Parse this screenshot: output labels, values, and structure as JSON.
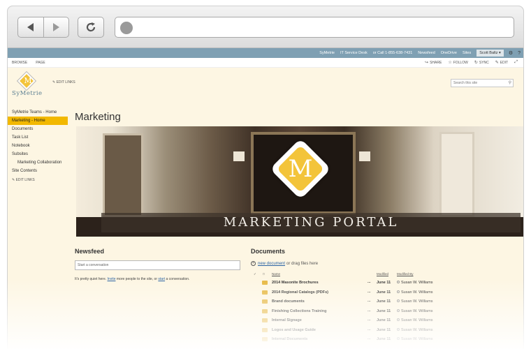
{
  "suitebar": {
    "links": [
      "SyMetrie",
      "IT Service Desk",
      "or Call 1-855-638-7431",
      "Newsfeed",
      "OneDrive",
      "Sites"
    ],
    "user": "Scott Baltz ▾"
  },
  "ribbon": {
    "tabs": [
      "BROWSE",
      "PAGE"
    ],
    "actions": {
      "share": "SHARE",
      "follow": "FOLLOW",
      "sync": "SYNC",
      "edit": "EDIT"
    }
  },
  "site": {
    "logo_letter": "M",
    "name": "SyMetrie",
    "edit_links": "EDIT LINKS",
    "search_placeholder": "Search this site"
  },
  "nav": {
    "items": [
      "SyMetrie Teams - Home",
      "Marketing - Home",
      "Documents",
      "Task List",
      "Notebook",
      "Subsites",
      "Marketing Collaboration",
      "Site Contents"
    ],
    "edit_links": "EDIT LINKS"
  },
  "page": {
    "title": "Marketing"
  },
  "banner": {
    "letter": "M",
    "text": "MARKETING PORTAL"
  },
  "newsfeed": {
    "title": "Newsfeed",
    "placeholder": "Start a conversation",
    "note_1": "It's pretty quiet here.",
    "invite": "Invite",
    "note_2": "more people to the site, or",
    "start": "start",
    "note_3": "a conversation."
  },
  "documents": {
    "title": "Documents",
    "new_document": "new document",
    "drag_text": "or drag files here",
    "columns": {
      "name": "Name",
      "modified": "Modified",
      "modified_by": "Modified By"
    },
    "rows": [
      {
        "name": "2014 Masonite Brochures",
        "modified": "June 11",
        "by": "Susan W. Williams"
      },
      {
        "name": "2014 Regional Catalogs (PDFs)",
        "modified": "June 11",
        "by": "Susan W. Williams"
      },
      {
        "name": "Brand documents",
        "modified": "June 11",
        "by": "Susan W. Williams"
      },
      {
        "name": "Finishing Collections Training",
        "modified": "June 11",
        "by": "Susan W. Williams"
      },
      {
        "name": "Internal Signage",
        "modified": "June 11",
        "by": "Susan W. Williams"
      },
      {
        "name": "Logos and Usage Guide",
        "modified": "June 11",
        "by": "Susan W. Williams"
      },
      {
        "name": "Internal Documents",
        "modified": "June 11",
        "by": "Susan W. Williams"
      }
    ]
  },
  "colors": {
    "accent": "#f2b800",
    "suitebar": "#7fa0b3",
    "page_bg": "#fdf6e3",
    "link": "#2a63a4"
  }
}
